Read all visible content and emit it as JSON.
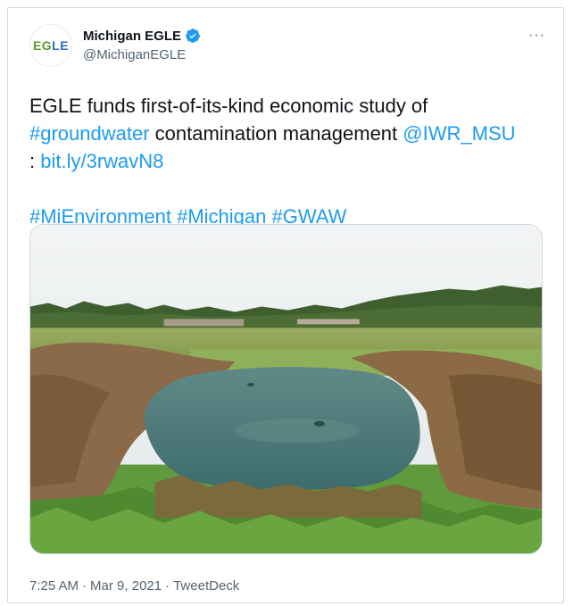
{
  "tweet": {
    "author": {
      "display_name": "Michigan EGLE",
      "handle": "@MichiganEGLE",
      "avatar_text": "EGLE",
      "verified": true
    },
    "more_label": "···",
    "text": {
      "line1_prefix": "EGLE funds first-of-its-kind economic study of ",
      "hashtag_groundwater": "#groundwater",
      "line1_middle": " contamination management ",
      "mention": "@IWR_MSU",
      "colon": " : ",
      "link": "bit.ly/3rwavN8",
      "hashtag_mienvironment": "#MiEnvironment",
      "hashtag_michigan": "#Michigan",
      "hashtag_gwaw": "#GWAW"
    },
    "meta": {
      "time": "7:25 AM",
      "date": "Mar 9, 2021",
      "source": "TweetDeck",
      "separator": "·"
    }
  },
  "colors": {
    "link": "#1d9bf0",
    "verified": "#1d9bf0",
    "secondary_text": "#536471",
    "avatar_green": "#5a9a2a",
    "avatar_blue": "#2a6db5"
  },
  "icons": {
    "verified": "verified-badge-icon",
    "more": "more-options-icon"
  }
}
